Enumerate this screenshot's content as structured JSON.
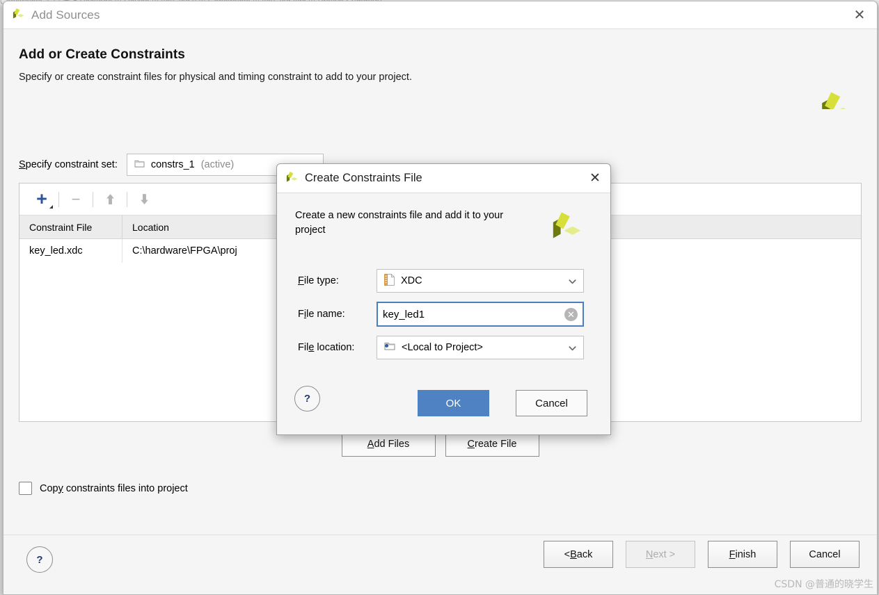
{
  "background_window": {
    "ghost_tabs": "Constraints      △   ⊟  ▣  ▮     Package     ⊞ Device     ⊞ key_led.v     ⊞ Constraints     ⊞ key_led.xdc        ⊞ Project Summary"
  },
  "wizard": {
    "window_title": "Add Sources",
    "logo_icon": "vivado-logo-icon",
    "close_icon": "close-icon",
    "header": {
      "title": "Add or Create Constraints",
      "subtitle": "Specify or create constraint files for physical and timing constraint to add to your project."
    },
    "constraint_set": {
      "label": "Specify constraint set:",
      "label_mnemonic": "S",
      "folder_icon": "folder-icon",
      "value": "constrs_1",
      "value_suffix": "(active)",
      "chevron_icon": "chevron-down-icon"
    },
    "file_toolbar": {
      "add_icon": "plus-icon",
      "remove_icon": "minus-icon",
      "move_up_icon": "arrow-up-icon",
      "move_down_icon": "arrow-down-icon"
    },
    "file_table": {
      "columns": [
        "Constraint File",
        "Location"
      ],
      "rows": [
        {
          "constraint_file": "key_led.xdc",
          "location": "C:\\hardware\\FPGA\\proj"
        }
      ]
    },
    "actions": {
      "add_files": "Add Files",
      "add_files_mnemonic": "A",
      "create_file": "Create File",
      "create_file_mnemonic": "C"
    },
    "copy_checkbox": {
      "label_a": "Cop",
      "label_mnemonic": "y",
      "label_b": " constraints files into project",
      "checked": false
    },
    "footer": {
      "help_label": "?",
      "buttons": [
        {
          "id": "back",
          "pre": "< ",
          "mnemonic": "B",
          "post": "ack",
          "disabled": false
        },
        {
          "id": "next",
          "pre": "",
          "mnemonic": "N",
          "post": "ext >",
          "disabled": true
        },
        {
          "id": "finish",
          "pre": "",
          "mnemonic": "F",
          "post": "inish",
          "disabled": false
        },
        {
          "id": "cancel",
          "pre": "",
          "mnemonic": "",
          "post": "Cancel",
          "disabled": false
        }
      ]
    }
  },
  "modal": {
    "title": "Create Constraints File",
    "logo_icon": "vivado-logo-icon",
    "close_icon": "close-icon",
    "description": "Create a new constraints file and add it to your project",
    "fields": {
      "file_type": {
        "label_pre": "",
        "label_mnemonic": "F",
        "label_post": "ile type:",
        "icon": "xdc-file-icon",
        "value": "XDC",
        "chevron_icon": "chevron-down-icon"
      },
      "file_name": {
        "label_pre": "F",
        "label_mnemonic": "i",
        "label_post": "le name:",
        "value": "key_led1",
        "placeholder": "",
        "clear_icon": "clear-circle-icon"
      },
      "file_location": {
        "label_pre": "Fil",
        "label_mnemonic": "e",
        "label_post": " location:",
        "icon": "folder-icon",
        "value": "<Local to Project>",
        "chevron_icon": "chevron-down-icon"
      }
    },
    "help_label": "?",
    "ok_label": "OK",
    "cancel_label": "Cancel"
  },
  "watermark": "CSDN @普通的晓学生",
  "colors": {
    "accent_blue": "#4f82c3",
    "plus_blue": "#2f5597",
    "logo_dark": "#6e7a10",
    "logo_bright": "#d7e03a",
    "logo_pale": "#e4ec8c",
    "help_navy": "#23396b"
  }
}
